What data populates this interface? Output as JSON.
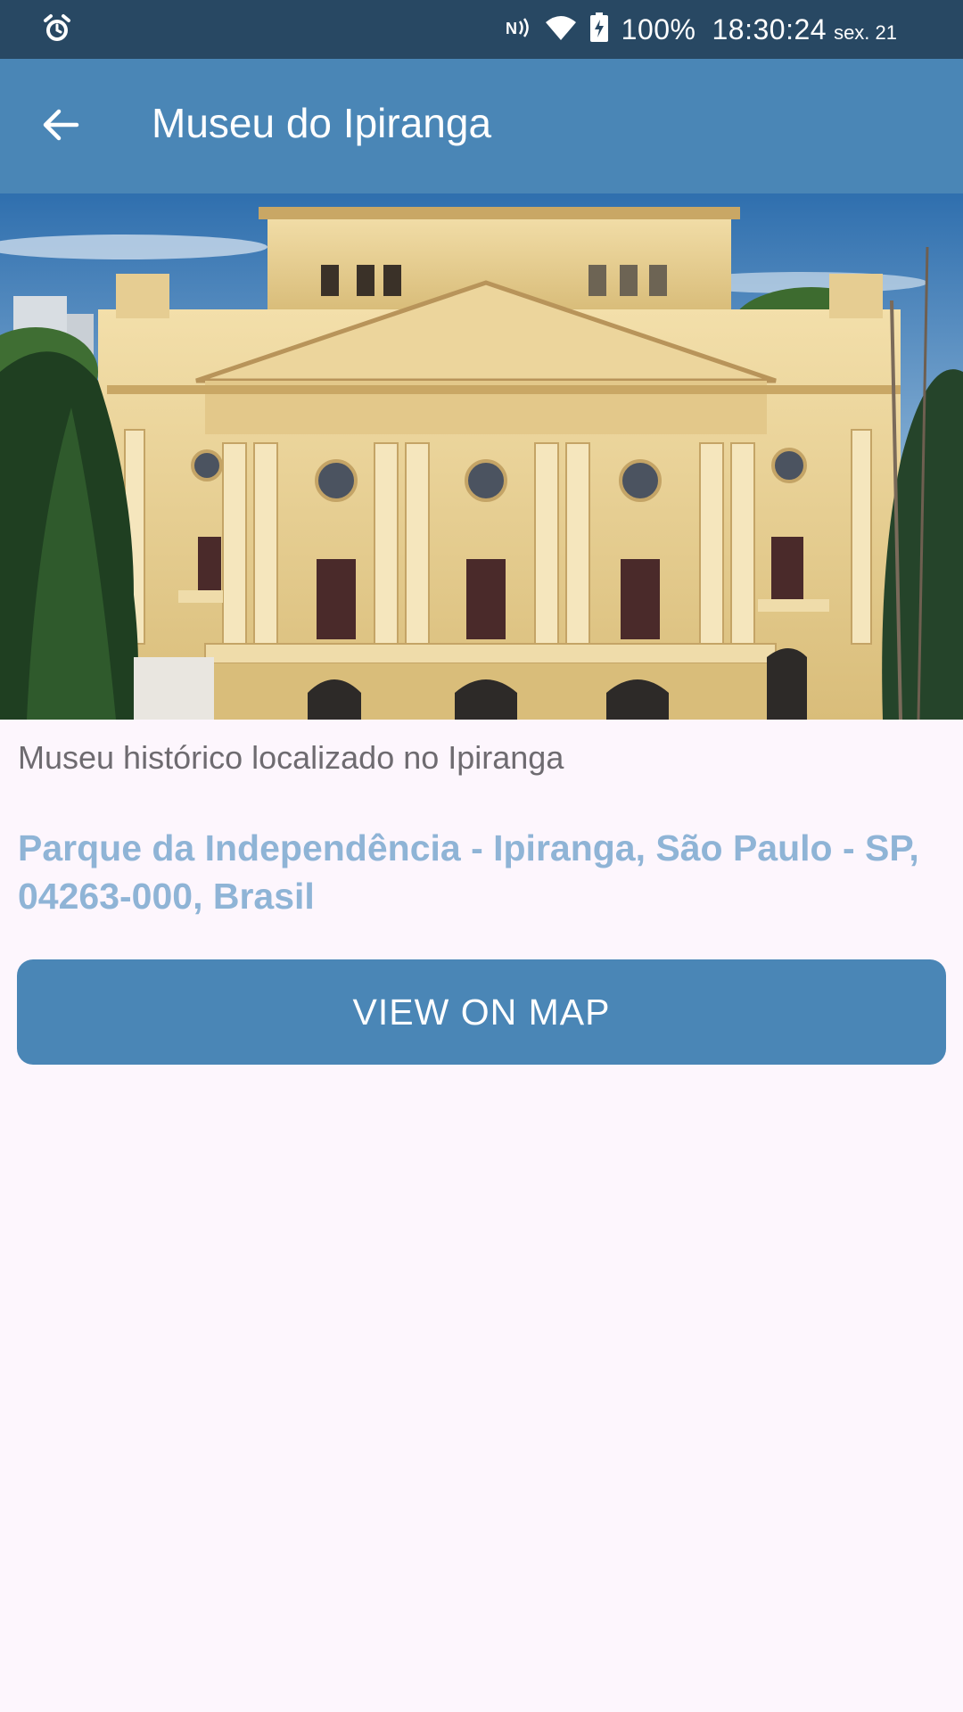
{
  "status_bar": {
    "alarm_icon": "alarm-clock-icon",
    "nfc_icon": "nfc-icon",
    "wifi_icon": "wifi-icon",
    "battery_icon": "battery-charging-icon",
    "battery_percent": "100%",
    "time": "18:30:24",
    "date": "sex. 21"
  },
  "app_bar": {
    "back_icon": "arrow-back-icon",
    "title": "Museu do Ipiranga"
  },
  "place": {
    "image_icon": "museum-building-photo",
    "description": "Museu histórico localizado no Ipiranga",
    "address": "Parque da Independência - Ipiranga, São Paulo - SP, 04263-000, Brasil"
  },
  "actions": {
    "view_on_map_label": "VIEW ON MAP"
  },
  "colors": {
    "status_bar": "#284863",
    "app_bar": "#4a86b6",
    "background": "#fdf6fd",
    "address_link": "#8fb4d6",
    "button": "#4a86b6"
  }
}
